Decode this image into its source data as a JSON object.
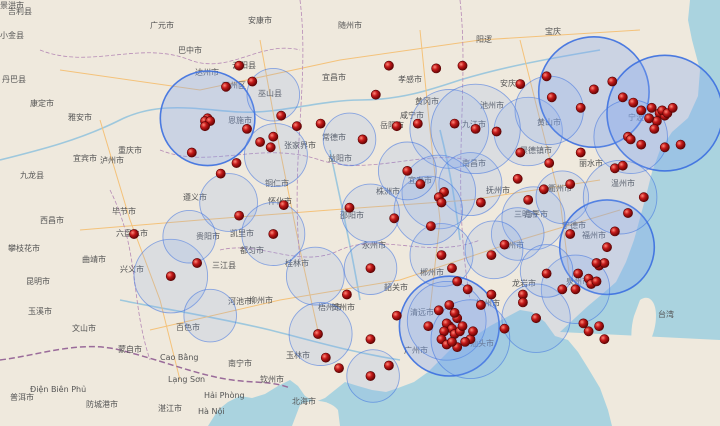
{
  "map": {
    "type": "point-buffer-map",
    "colors": {
      "land": "#efe9dd",
      "sea": "#aad3df",
      "road": "#f4c27a",
      "river": "#9ec8dd",
      "border": "#b68ab6",
      "circle_fill": "#7ea6f0",
      "circle_stroke": "#3b6fe0",
      "marker": "#a80f0f",
      "marker_highlight": "#ff8a7a"
    },
    "labels": [
      {
        "text": "吉利县"
      },
      {
        "text": "小金县"
      },
      {
        "text": "广元市"
      },
      {
        "text": "巴中市"
      },
      {
        "text": "安康市"
      },
      {
        "text": "随州市"
      },
      {
        "text": "阳逻"
      },
      {
        "text": "宝庆"
      },
      {
        "text": "丹巴县"
      },
      {
        "text": "达州市"
      },
      {
        "text": "万州区"
      },
      {
        "text": "云阳县"
      },
      {
        "text": "巫山县"
      },
      {
        "text": "宜昌市"
      },
      {
        "text": "孝感市"
      },
      {
        "text": "黄冈市"
      },
      {
        "text": "安庆市"
      },
      {
        "text": "池州市"
      },
      {
        "text": "九江市"
      },
      {
        "text": "黄山市"
      },
      {
        "text": "宁波市"
      },
      {
        "text": "康定市"
      },
      {
        "text": "雅安市"
      },
      {
        "text": "宜宾市"
      },
      {
        "text": "泸州市"
      },
      {
        "text": "重庆市"
      },
      {
        "text": "恩施市"
      },
      {
        "text": "张家界市"
      },
      {
        "text": "常德市"
      },
      {
        "text": "益阳市"
      },
      {
        "text": "岳阳市"
      },
      {
        "text": "咸宁市"
      },
      {
        "text": "南昌市"
      },
      {
        "text": "景德镇市"
      },
      {
        "text": "衢州市"
      },
      {
        "text": "丽水市"
      },
      {
        "text": "温州市"
      },
      {
        "text": "九龙县"
      },
      {
        "text": "西昌市"
      },
      {
        "text": "毕节市"
      },
      {
        "text": "遵义市"
      },
      {
        "text": "铜仁市"
      },
      {
        "text": "怀化市"
      },
      {
        "text": "邵阳市"
      },
      {
        "text": "株洲市"
      },
      {
        "text": "宜春市"
      },
      {
        "text": "抚州市"
      },
      {
        "text": "南平市"
      },
      {
        "text": "宁德市"
      },
      {
        "text": "攀枝花市"
      },
      {
        "text": "六盘水市"
      },
      {
        "text": "贵阳市"
      },
      {
        "text": "凯里市"
      },
      {
        "text": "都匀市"
      },
      {
        "text": "三江县"
      },
      {
        "text": "永州市"
      },
      {
        "text": "郴州市"
      },
      {
        "text": "赣州市"
      },
      {
        "text": "三明市"
      },
      {
        "text": "福州市"
      },
      {
        "text": "曲靖市"
      },
      {
        "text": "兴义市"
      },
      {
        "text": "河池市"
      },
      {
        "text": "柳州市"
      },
      {
        "text": "桂林市"
      },
      {
        "text": "贺州市"
      },
      {
        "text": "韶关市"
      },
      {
        "text": "梅州市"
      },
      {
        "text": "龙岩市"
      },
      {
        "text": "泉州市"
      },
      {
        "text": "台湾"
      },
      {
        "text": "昆明市"
      },
      {
        "text": "玉溪市"
      },
      {
        "text": "文山市"
      },
      {
        "text": "百色市"
      },
      {
        "text": "南宁市"
      },
      {
        "text": "玉林市"
      },
      {
        "text": "梧州市"
      },
      {
        "text": "清远市"
      },
      {
        "text": "广州市"
      },
      {
        "text": "汕头市"
      },
      {
        "text": "蒙自市"
      },
      {
        "text": "Cao Bằng"
      },
      {
        "text": "Lạng Sơn"
      },
      {
        "text": "钦州市"
      },
      {
        "text": "北海市"
      },
      {
        "text": "湛江市"
      },
      {
        "text": "Hà Nội"
      },
      {
        "text": "Hải Phòng"
      },
      {
        "text": "防城港市"
      },
      {
        "text": "Điện Biên Phủ"
      },
      {
        "text": "普洱市"
      },
      {
        "text": "景洪市"
      }
    ],
    "circles": [
      {
        "lon": 104.1,
        "lat": 31.0,
        "r": 1.8,
        "strong": true
      },
      {
        "lon": 106.7,
        "lat": 29.6,
        "r": 1.2,
        "strong": false
      },
      {
        "lon": 104.9,
        "lat": 27.8,
        "r": 1.1,
        "strong": false
      },
      {
        "lon": 106.6,
        "lat": 31.9,
        "r": 1.0,
        "strong": false
      },
      {
        "lon": 109.5,
        "lat": 30.2,
        "r": 1.0,
        "strong": false
      },
      {
        "lon": 113.3,
        "lat": 30.6,
        "r": 1.5,
        "strong": false
      },
      {
        "lon": 116.3,
        "lat": 30.5,
        "r": 1.3,
        "strong": false
      },
      {
        "lon": 114.1,
        "lat": 28.5,
        "r": 1.2,
        "strong": false
      },
      {
        "lon": 112.9,
        "lat": 28.2,
        "r": 1.4,
        "strong": false
      },
      {
        "lon": 116.5,
        "lat": 27.2,
        "r": 1.2,
        "strong": false
      },
      {
        "lon": 117.6,
        "lat": 28.0,
        "r": 1.0,
        "strong": false
      },
      {
        "lon": 118.8,
        "lat": 32.0,
        "r": 2.1,
        "strong": true
      },
      {
        "lon": 121.5,
        "lat": 31.2,
        "r": 2.2,
        "strong": true
      },
      {
        "lon": 120.2,
        "lat": 30.3,
        "r": 1.4,
        "strong": false
      },
      {
        "lon": 117.1,
        "lat": 31.3,
        "r": 1.3,
        "strong": false
      },
      {
        "lon": 114.3,
        "lat": 30.6,
        "r": 1.7,
        "strong": false
      },
      {
        "lon": 106.6,
        "lat": 26.6,
        "r": 1.2,
        "strong": false
      },
      {
        "lon": 102.7,
        "lat": 25.0,
        "r": 1.4,
        "strong": false
      },
      {
        "lon": 103.4,
        "lat": 26.5,
        "r": 1.0,
        "strong": false
      },
      {
        "lon": 113.0,
        "lat": 25.8,
        "r": 1.2,
        "strong": false
      },
      {
        "lon": 115.9,
        "lat": 26.6,
        "r": 1.0,
        "strong": false
      },
      {
        "lon": 119.3,
        "lat": 26.1,
        "r": 1.8,
        "strong": true
      },
      {
        "lon": 118.1,
        "lat": 24.5,
        "r": 1.3,
        "strong": false
      },
      {
        "lon": 116.6,
        "lat": 23.4,
        "r": 1.3,
        "strong": false
      },
      {
        "lon": 113.3,
        "lat": 23.1,
        "r": 1.9,
        "strong": true
      },
      {
        "lon": 113.2,
        "lat": 23.3,
        "r": 1.5,
        "strong": false
      },
      {
        "lon": 114.1,
        "lat": 22.6,
        "r": 1.5,
        "strong": false
      },
      {
        "lon": 110.3,
        "lat": 25.3,
        "r": 1.0,
        "strong": false
      },
      {
        "lon": 108.4,
        "lat": 22.8,
        "r": 1.2,
        "strong": false
      },
      {
        "lon": 110.4,
        "lat": 21.2,
        "r": 1.0,
        "strong": false
      },
      {
        "lon": 104.2,
        "lat": 23.5,
        "r": 1.0,
        "strong": false
      },
      {
        "lon": 112.5,
        "lat": 27.5,
        "r": 1.3,
        "strong": false
      },
      {
        "lon": 115.0,
        "lat": 26.0,
        "r": 1.1,
        "strong": false
      },
      {
        "lon": 117.0,
        "lat": 25.2,
        "r": 1.0,
        "strong": false
      },
      {
        "lon": 119.8,
        "lat": 28.0,
        "r": 1.4,
        "strong": false
      },
      {
        "lon": 110.3,
        "lat": 27.4,
        "r": 1.1,
        "strong": false
      },
      {
        "lon": 108.2,
        "lat": 25.0,
        "r": 1.1,
        "strong": false
      },
      {
        "lon": 111.7,
        "lat": 29.0,
        "r": 1.1,
        "strong": false
      }
    ],
    "markers": [
      {
        "lon": 104.1,
        "lat": 31.0
      },
      {
        "lon": 104.0,
        "lat": 30.9
      },
      {
        "lon": 104.2,
        "lat": 30.9
      },
      {
        "lon": 104.0,
        "lat": 30.7
      },
      {
        "lon": 103.5,
        "lat": 29.7
      },
      {
        "lon": 104.8,
        "lat": 32.2
      },
      {
        "lon": 105.3,
        "lat": 33.0
      },
      {
        "lon": 105.8,
        "lat": 32.4
      },
      {
        "lon": 106.9,
        "lat": 31.1
      },
      {
        "lon": 106.6,
        "lat": 30.3
      },
      {
        "lon": 105.6,
        "lat": 30.6
      },
      {
        "lon": 106.1,
        "lat": 30.1
      },
      {
        "lon": 106.5,
        "lat": 29.9
      },
      {
        "lon": 105.2,
        "lat": 29.3
      },
      {
        "lon": 104.6,
        "lat": 28.9
      },
      {
        "lon": 107.5,
        "lat": 30.7
      },
      {
        "lon": 108.4,
        "lat": 30.8
      },
      {
        "lon": 110.0,
        "lat": 30.2
      },
      {
        "lon": 111.0,
        "lat": 33.0
      },
      {
        "lon": 112.8,
        "lat": 32.9
      },
      {
        "lon": 113.8,
        "lat": 33.0
      },
      {
        "lon": 112.1,
        "lat": 30.8
      },
      {
        "lon": 113.5,
        "lat": 30.8
      },
      {
        "lon": 114.3,
        "lat": 30.6
      },
      {
        "lon": 115.1,
        "lat": 30.5
      },
      {
        "lon": 116.0,
        "lat": 32.3
      },
      {
        "lon": 117.0,
        "lat": 32.6
      },
      {
        "lon": 117.2,
        "lat": 31.8
      },
      {
        "lon": 118.3,
        "lat": 31.4
      },
      {
        "lon": 118.8,
        "lat": 32.1
      },
      {
        "lon": 119.5,
        "lat": 32.4
      },
      {
        "lon": 119.9,
        "lat": 31.8
      },
      {
        "lon": 120.3,
        "lat": 31.6
      },
      {
        "lon": 120.6,
        "lat": 31.3
      },
      {
        "lon": 121.0,
        "lat": 31.4
      },
      {
        "lon": 121.3,
        "lat": 31.2
      },
      {
        "lon": 121.5,
        "lat": 31.1
      },
      {
        "lon": 121.4,
        "lat": 31.3
      },
      {
        "lon": 121.6,
        "lat": 31.2
      },
      {
        "lon": 121.2,
        "lat": 30.9
      },
      {
        "lon": 120.9,
        "lat": 31.0
      },
      {
        "lon": 120.1,
        "lat": 30.3
      },
      {
        "lon": 120.2,
        "lat": 30.2
      },
      {
        "lon": 120.6,
        "lat": 30.0
      },
      {
        "lon": 121.5,
        "lat": 29.9
      },
      {
        "lon": 121.1,
        "lat": 30.6
      },
      {
        "lon": 119.6,
        "lat": 29.1
      },
      {
        "lon": 120.7,
        "lat": 28.0
      },
      {
        "lon": 118.3,
        "lat": 29.7
      },
      {
        "lon": 117.1,
        "lat": 29.3
      },
      {
        "lon": 116.0,
        "lat": 29.7
      },
      {
        "lon": 115.9,
        "lat": 28.7
      },
      {
        "lon": 116.9,
        "lat": 28.3
      },
      {
        "lon": 117.9,
        "lat": 28.5
      },
      {
        "lon": 119.9,
        "lat": 29.2
      },
      {
        "lon": 121.8,
        "lat": 31.4
      },
      {
        "lon": 122.1,
        "lat": 30.0
      },
      {
        "lon": 113.1,
        "lat": 28.2
      },
      {
        "lon": 112.9,
        "lat": 28.0
      },
      {
        "lon": 113.0,
        "lat": 27.8
      },
      {
        "lon": 112.2,
        "lat": 28.5
      },
      {
        "lon": 111.7,
        "lat": 29.0
      },
      {
        "lon": 111.3,
        "lat": 30.7
      },
      {
        "lon": 110.5,
        "lat": 31.9
      },
      {
        "lon": 109.5,
        "lat": 27.6
      },
      {
        "lon": 111.2,
        "lat": 27.2
      },
      {
        "lon": 112.6,
        "lat": 26.9
      },
      {
        "lon": 113.0,
        "lat": 25.8
      },
      {
        "lon": 114.5,
        "lat": 27.8
      },
      {
        "lon": 114.9,
        "lat": 25.8
      },
      {
        "lon": 115.4,
        "lat": 26.2
      },
      {
        "lon": 116.3,
        "lat": 27.9
      },
      {
        "lon": 117.9,
        "lat": 26.6
      },
      {
        "lon": 118.2,
        "lat": 25.1
      },
      {
        "lon": 119.3,
        "lat": 26.1
      },
      {
        "lon": 119.6,
        "lat": 26.7
      },
      {
        "lon": 120.1,
        "lat": 27.4
      },
      {
        "lon": 117.0,
        "lat": 25.1
      },
      {
        "lon": 116.1,
        "lat": 24.3
      },
      {
        "lon": 116.6,
        "lat": 23.4
      },
      {
        "lon": 117.6,
        "lat": 24.5
      },
      {
        "lon": 118.1,
        "lat": 24.5
      },
      {
        "lon": 118.6,
        "lat": 24.9
      },
      {
        "lon": 119.0,
        "lat": 25.4
      },
      {
        "lon": 118.7,
        "lat": 24.7
      },
      {
        "lon": 118.9,
        "lat": 24.8
      },
      {
        "lon": 119.2,
        "lat": 25.5
      },
      {
        "lon": 118.9,
        "lat": 25.5
      },
      {
        "lon": 118.4,
        "lat": 23.2
      },
      {
        "lon": 118.6,
        "lat": 22.9
      },
      {
        "lon": 119.0,
        "lat": 23.1
      },
      {
        "lon": 119.2,
        "lat": 22.6
      },
      {
        "lon": 114.1,
        "lat": 22.6
      },
      {
        "lon": 113.3,
        "lat": 23.1
      },
      {
        "lon": 113.2,
        "lat": 23.2
      },
      {
        "lon": 113.4,
        "lat": 23.0
      },
      {
        "lon": 113.5,
        "lat": 22.8
      },
      {
        "lon": 113.7,
        "lat": 22.9
      },
      {
        "lon": 113.8,
        "lat": 23.1
      },
      {
        "lon": 113.6,
        "lat": 23.4
      },
      {
        "lon": 113.1,
        "lat": 22.9
      },
      {
        "lon": 113.0,
        "lat": 22.6
      },
      {
        "lon": 113.6,
        "lat": 22.3
      },
      {
        "lon": 113.2,
        "lat": 22.4
      },
      {
        "lon": 113.4,
        "lat": 22.5
      },
      {
        "lon": 113.9,
        "lat": 22.5
      },
      {
        "lon": 114.2,
        "lat": 22.9
      },
      {
        "lon": 113.5,
        "lat": 23.6
      },
      {
        "lon": 113.3,
        "lat": 23.9
      },
      {
        "lon": 112.9,
        "lat": 23.7
      },
      {
        "lon": 112.5,
        "lat": 23.1
      },
      {
        "lon": 114.5,
        "lat": 23.9
      },
      {
        "lon": 115.4,
        "lat": 23.0
      },
      {
        "lon": 116.1,
        "lat": 24.0
      },
      {
        "lon": 114.0,
        "lat": 24.5
      },
      {
        "lon": 113.4,
        "lat": 25.3
      },
      {
        "lon": 114.9,
        "lat": 24.3
      },
      {
        "lon": 111.3,
        "lat": 23.5
      },
      {
        "lon": 110.3,
        "lat": 22.6
      },
      {
        "lon": 109.4,
        "lat": 24.3
      },
      {
        "lon": 110.3,
        "lat": 25.3
      },
      {
        "lon": 108.3,
        "lat": 22.8
      },
      {
        "lon": 108.6,
        "lat": 21.9
      },
      {
        "lon": 109.1,
        "lat": 21.5
      },
      {
        "lon": 110.3,
        "lat": 21.2
      },
      {
        "lon": 111.0,
        "lat": 21.6
      },
      {
        "lon": 113.6,
        "lat": 24.8
      },
      {
        "lon": 106.6,
        "lat": 26.6
      },
      {
        "lon": 107.0,
        "lat": 27.7
      },
      {
        "lon": 105.3,
        "lat": 27.3
      },
      {
        "lon": 102.7,
        "lat": 25.0
      },
      {
        "lon": 101.3,
        "lat": 26.6
      },
      {
        "lon": 103.7,
        "lat": 25.5
      }
    ]
  }
}
